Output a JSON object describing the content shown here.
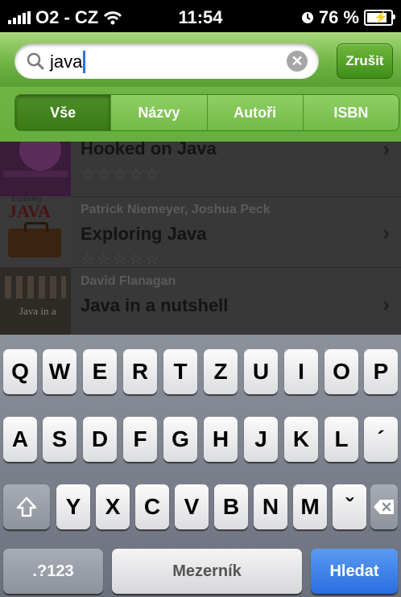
{
  "status_bar": {
    "carrier": "O2 - CZ",
    "time": "11:54",
    "battery": "76 %"
  },
  "search": {
    "query": "java",
    "cancel_label": "Zrušit"
  },
  "scopes": {
    "items": [
      "Vše",
      "Názvy",
      "Autoři",
      "ISBN"
    ],
    "selected": "Vše"
  },
  "results": [
    {
      "author": "",
      "title": "Hooked on Java",
      "stars": "☆☆☆☆☆"
    },
    {
      "author": "Patrick Niemeyer, Joshua Peck",
      "title": "Exploring Java",
      "stars": "☆☆☆☆☆"
    },
    {
      "author": "David Flanagan",
      "title": "Java in a nutshell",
      "stars": ""
    }
  ],
  "covers": {
    "exploring_java_label": "JAVA",
    "exploring_java_small": "Exploring",
    "nutshell_label": "Java in a"
  },
  "keyboard": {
    "row1": [
      "Q",
      "W",
      "E",
      "R",
      "T",
      "Z",
      "U",
      "I",
      "O",
      "P"
    ],
    "row2": [
      "A",
      "S",
      "D",
      "F",
      "G",
      "H",
      "J",
      "K",
      "L",
      "´"
    ],
    "row3": [
      "Y",
      "X",
      "C",
      "V",
      "B",
      "N",
      "M",
      "ˇ"
    ],
    "numbers_label": ".?123",
    "space_label": "Mezerník",
    "search_label": "Hledat"
  },
  "colors": {
    "accent_green": "#6fb544",
    "keyboard_blue": "#2a6ee0"
  }
}
